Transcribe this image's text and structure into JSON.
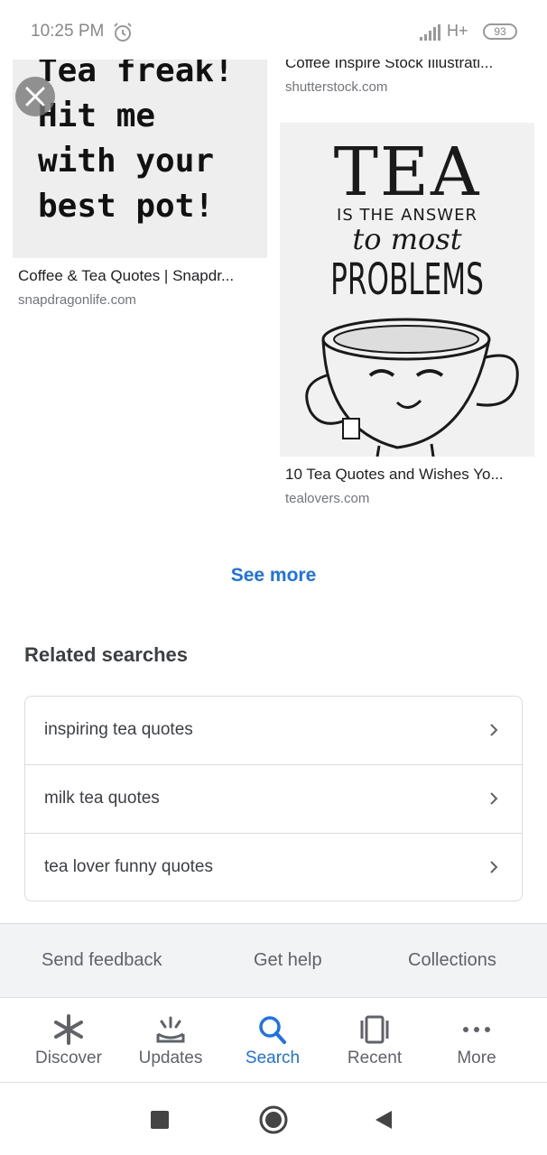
{
  "status_bar": {
    "time": "10:25 PM",
    "network": "H+",
    "battery": "93"
  },
  "results": {
    "left": {
      "image_text": "Tea freak!\nHit me\nwith your\nbest pot!",
      "title": "Coffee & Tea Quotes | Snapdr...",
      "source": "snapdragonlife.com"
    },
    "right_top": {
      "title": "Coffee Inspire Stock Illustrati...",
      "source": "shutterstock.com"
    },
    "right": {
      "image_text_1": "TEA",
      "image_text_2": "IS THE ANSWER",
      "image_text_3": "to most",
      "image_text_4": "PROBLEMS",
      "title": "10 Tea Quotes and Wishes Yo...",
      "source": "tealovers.com"
    }
  },
  "see_more": "See more",
  "related": {
    "title": "Related searches",
    "items": [
      {
        "label": "inspiring tea quotes"
      },
      {
        "label": "milk tea quotes"
      },
      {
        "label": "tea lover funny quotes"
      }
    ]
  },
  "footer": {
    "send_feedback": "Send feedback",
    "get_help": "Get help",
    "collections": "Collections"
  },
  "bottom_nav": {
    "discover": "Discover",
    "updates": "Updates",
    "search": "Search",
    "recent": "Recent",
    "more": "More"
  },
  "colors": {
    "accent": "#1a73e8",
    "text_secondary": "#5f6368"
  }
}
